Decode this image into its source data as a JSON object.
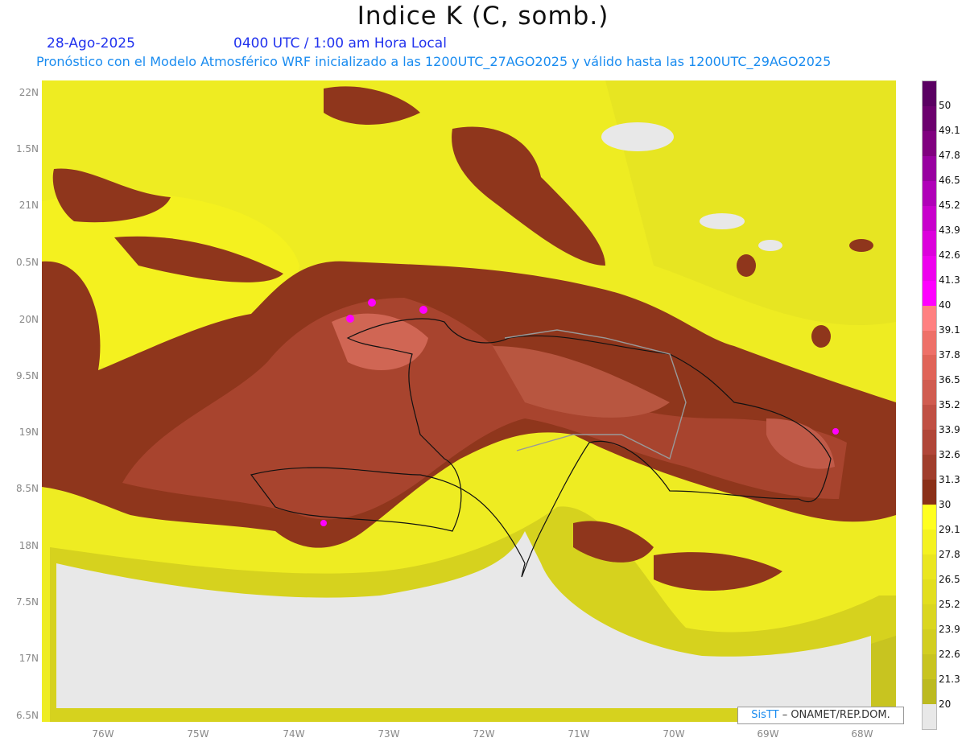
{
  "header": {
    "title": "Indice K (C, somb.)",
    "date": "28-Ago-2025",
    "time": "0400 UTC / 1:00 am Hora Local",
    "subtitle": "Pronóstico con el Modelo Atmosférico WRF inicializado a las 1200UTC_27AGO2025 y válido hasta las  1200UTC_29AGO2025"
  },
  "axes": {
    "lat_labels": [
      "22N",
      "1.5N",
      "21N",
      "0.5N",
      "20N",
      "9.5N",
      "19N",
      "8.5N",
      "18N",
      "7.5N",
      "17N",
      "6.5N"
    ],
    "lon_labels": [
      "76W",
      "75W",
      "74W",
      "73W",
      "72W",
      "71W",
      "70W",
      "69W",
      "68W"
    ]
  },
  "colorbar": {
    "labels": [
      "50",
      "49.1",
      "47.8",
      "46.5",
      "45.2",
      "43.9",
      "42.6",
      "41.3",
      "40",
      "39.1",
      "37.8",
      "36.5",
      "35.2",
      "33.9",
      "32.6",
      "31.3",
      "30",
      "29.1",
      "27.8",
      "26.5",
      "25.2",
      "23.9",
      "22.6",
      "21.3",
      "20"
    ],
    "colors": [
      "#5a0062",
      "#6c006e",
      "#80007f",
      "#9800a0",
      "#b000b8",
      "#c800cc",
      "#dc00dc",
      "#ee00ee",
      "#ff00ff",
      "#ff8080",
      "#ee7068",
      "#e06458",
      "#d05c50",
      "#c05044",
      "#b04638",
      "#a03e2c",
      "#8a3018",
      "#ffff20",
      "#f4f220",
      "#eae620",
      "#e2de1e",
      "#dad620",
      "#d2ce20",
      "#c8c420",
      "#bcba20",
      "#e8e8e8"
    ]
  },
  "credit": {
    "brand": "SisTT",
    "text": " – ONAMET/REP.DOM."
  }
}
